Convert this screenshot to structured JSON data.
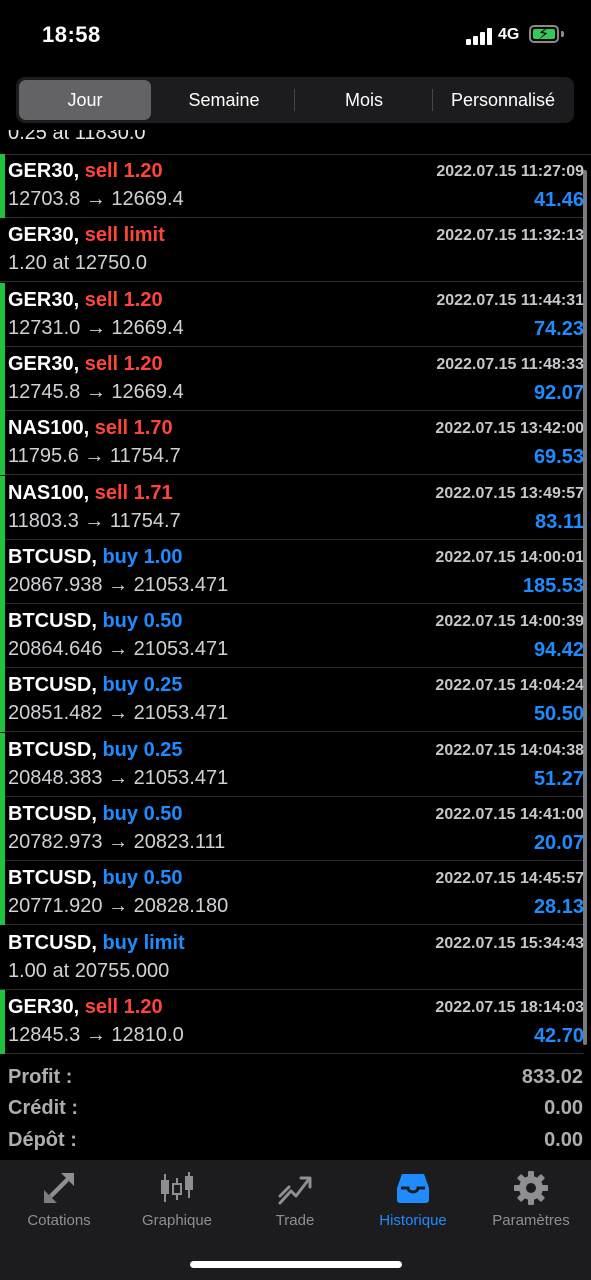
{
  "status": {
    "time": "18:58",
    "network": "4G"
  },
  "tabs_top": [
    {
      "label": "Jour",
      "active": true
    },
    {
      "label": "Semaine",
      "active": false
    },
    {
      "label": "Mois",
      "active": false
    },
    {
      "label": "Personnalisé",
      "active": false
    }
  ],
  "partial_row": {
    "text": "0.25 at 11830.0"
  },
  "rows": [
    {
      "symbol": "GER30,",
      "side": "sell 1.20",
      "side_type": "sell",
      "datetime": "2022.07.15 11:27:09",
      "prices": "12703.8 → 12669.4",
      "profit": "41.46",
      "bar": true
    },
    {
      "symbol": "GER30,",
      "side": "sell limit",
      "side_type": "sell",
      "datetime": "2022.07.15 11:32:13",
      "prices": "1.20 at 12750.0",
      "profit": "",
      "bar": false
    },
    {
      "symbol": "GER30,",
      "side": "sell 1.20",
      "side_type": "sell",
      "datetime": "2022.07.15 11:44:31",
      "prices": "12731.0 → 12669.4",
      "profit": "74.23",
      "bar": true
    },
    {
      "symbol": "GER30,",
      "side": "sell 1.20",
      "side_type": "sell",
      "datetime": "2022.07.15 11:48:33",
      "prices": "12745.8 → 12669.4",
      "profit": "92.07",
      "bar": true
    },
    {
      "symbol": "NAS100,",
      "side": "sell 1.70",
      "side_type": "sell",
      "datetime": "2022.07.15 13:42:00",
      "prices": "11795.6 → 11754.7",
      "profit": "69.53",
      "bar": true
    },
    {
      "symbol": "NAS100,",
      "side": "sell 1.71",
      "side_type": "sell",
      "datetime": "2022.07.15 13:49:57",
      "prices": "11803.3 → 11754.7",
      "profit": "83.11",
      "bar": true
    },
    {
      "symbol": "BTCUSD,",
      "side": "buy 1.00",
      "side_type": "buy",
      "datetime": "2022.07.15 14:00:01",
      "prices": "20867.938 → 21053.471",
      "profit": "185.53",
      "bar": true
    },
    {
      "symbol": "BTCUSD,",
      "side": "buy 0.50",
      "side_type": "buy",
      "datetime": "2022.07.15 14:00:39",
      "prices": "20864.646 → 21053.471",
      "profit": "94.42",
      "bar": true
    },
    {
      "symbol": "BTCUSD,",
      "side": "buy 0.25",
      "side_type": "buy",
      "datetime": "2022.07.15 14:04:24",
      "prices": "20851.482 → 21053.471",
      "profit": "50.50",
      "bar": true
    },
    {
      "symbol": "BTCUSD,",
      "side": "buy 0.25",
      "side_type": "buy",
      "datetime": "2022.07.15 14:04:38",
      "prices": "20848.383 → 21053.471",
      "profit": "51.27",
      "bar": true
    },
    {
      "symbol": "BTCUSD,",
      "side": "buy 0.50",
      "side_type": "buy",
      "datetime": "2022.07.15 14:41:00",
      "prices": "20782.973 → 20823.111",
      "profit": "20.07",
      "bar": true
    },
    {
      "symbol": "BTCUSD,",
      "side": "buy 0.50",
      "side_type": "buy",
      "datetime": "2022.07.15 14:45:57",
      "prices": "20771.920 → 20828.180",
      "profit": "28.13",
      "bar": true
    },
    {
      "symbol": "BTCUSD,",
      "side": "buy limit",
      "side_type": "buy",
      "datetime": "2022.07.15 15:34:43",
      "prices": "1.00 at 20755.000",
      "profit": "",
      "bar": false
    },
    {
      "symbol": "GER30,",
      "side": "sell 1.20",
      "side_type": "sell",
      "datetime": "2022.07.15 18:14:03",
      "prices": "12845.3 → 12810.0",
      "profit": "42.70",
      "bar": true
    }
  ],
  "summary": {
    "profit_label": "Profit :",
    "profit_value": "833.02",
    "credit_label": "Crédit :",
    "credit_value": "0.00",
    "deposit_label": "Dépôt :",
    "deposit_value": "0.00"
  },
  "tabbar": [
    {
      "label": "Cotations",
      "icon": "quotes-arrows-icon",
      "active": false
    },
    {
      "label": "Graphique",
      "icon": "candlestick-chart-icon",
      "active": false
    },
    {
      "label": "Trade",
      "icon": "trade-trend-icon",
      "active": false
    },
    {
      "label": "Historique",
      "icon": "history-inbox-icon",
      "active": true
    },
    {
      "label": "Paramètres",
      "icon": "settings-gear-icon",
      "active": false
    }
  ],
  "colors": {
    "sell": "#ff453a",
    "buy": "#1e8cff",
    "profit": "#1e8cff",
    "bar": "#1fc33e",
    "active_tab": "#1e8cff"
  }
}
